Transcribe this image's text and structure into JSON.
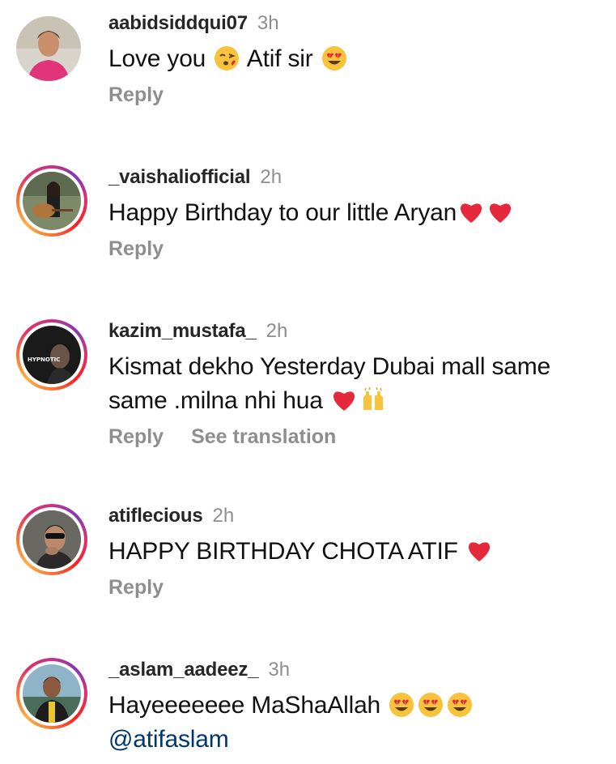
{
  "comments": [
    {
      "username": "aabidsiddqui07",
      "time": "3h",
      "text_parts": [
        "Love you",
        "Atif sir"
      ],
      "emojis": [
        "kissing-face-emoji",
        "heart-eyes-emoji"
      ],
      "actions": [
        "Reply"
      ]
    },
    {
      "username": "_vaishaliofficial",
      "time": "2h",
      "text_parts": [
        "Happy Birthday to our little  Aryan"
      ],
      "emojis": [
        "red-heart-emoji",
        "red-heart-emoji"
      ],
      "actions": [
        "Reply"
      ]
    },
    {
      "username": "kazim_mustafa_",
      "time": "2h",
      "text_parts": [
        "Kismat dekho Yesterday  Dubai mall same same .milna nhi hua"
      ],
      "emojis": [
        "red-heart-emoji",
        "raising-hands-emoji"
      ],
      "avatar_text": "HYPNOTIC",
      "actions": [
        "Reply",
        "See translation"
      ]
    },
    {
      "username": "atiflecious",
      "time": "2h",
      "text_parts": [
        "HAPPY BIRTHDAY CHOTA ATIF"
      ],
      "emojis": [
        "red-heart-emoji"
      ],
      "actions": [
        "Reply"
      ]
    },
    {
      "username": "_aslam_aadeez_",
      "time": "3h",
      "text_parts": [
        "Hayeeeeeee MaShaAllah",
        "@atifaslam"
      ],
      "emojis": [
        "heart-eyes-emoji",
        "heart-eyes-emoji",
        "heart-eyes-emoji"
      ],
      "actions": []
    }
  ],
  "colors": {
    "username": "#262626",
    "secondary": "#8e8e8e",
    "mention": "#00376b",
    "story_ring": [
      "#c13584",
      "#e1306c",
      "#fd1d1d",
      "#f77737",
      "#fcaf45"
    ]
  }
}
